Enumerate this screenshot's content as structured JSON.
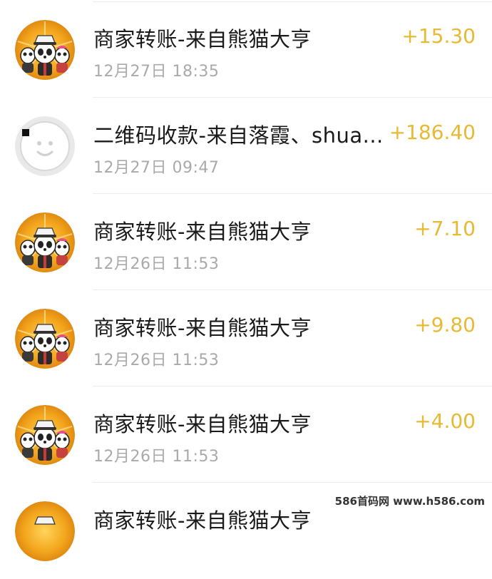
{
  "transactions": [
    {
      "title": "商家转账-来自熊猫大亨",
      "time": "12月27日 18:35",
      "amount": "+15.30",
      "avatar": "panda-avatar-icon"
    },
    {
      "title": "二维码收款-来自落霞、shua...",
      "time": "12月27日 09:47",
      "amount": "+186.40",
      "avatar": "default-avatar-icon"
    },
    {
      "title": "商家转账-来自熊猫大亨",
      "time": "12月26日 11:53",
      "amount": "+7.10",
      "avatar": "panda-avatar-icon"
    },
    {
      "title": "商家转账-来自熊猫大亨",
      "time": "12月26日 11:53",
      "amount": "+9.80",
      "avatar": "panda-avatar-icon"
    },
    {
      "title": "商家转账-来自熊猫大亨",
      "time": "12月26日 11:53",
      "amount": "+4.00",
      "avatar": "panda-avatar-icon"
    },
    {
      "title": "商家转账-来自熊猫大亨",
      "time": "",
      "amount": "",
      "avatar": "panda-avatar-icon"
    }
  ],
  "watermark": "586首码网 www.h586.com",
  "colors": {
    "amount": "#e8b932",
    "title": "#1a1a1a",
    "time": "#a9a9a9",
    "divider": "#ececec"
  }
}
